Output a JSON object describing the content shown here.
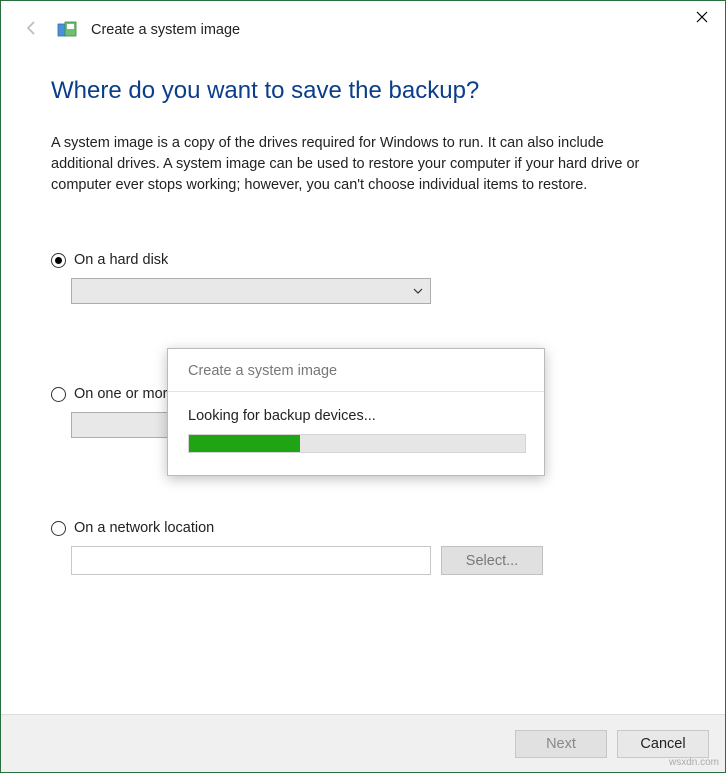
{
  "window": {
    "wizard_title": "Create a system image"
  },
  "page": {
    "heading": "Where do you want to save the backup?",
    "description": "A system image is a copy of the drives required for Windows to run. It can also include additional drives. A system image can be used to restore your computer if your hard drive or computer ever stops working; however, you can't choose individual items to restore."
  },
  "options": {
    "hard_disk": {
      "label": "On a hard disk",
      "selected": true
    },
    "dvd": {
      "label": "On one or more",
      "selected": false
    },
    "network": {
      "label": "On a network location",
      "selected": false,
      "select_button": "Select..."
    }
  },
  "dialog": {
    "title": "Create a system image",
    "message": "Looking for backup devices...",
    "progress_percent": 33
  },
  "footer": {
    "next": "Next",
    "cancel": "Cancel"
  },
  "watermark": "wsxdn.com"
}
